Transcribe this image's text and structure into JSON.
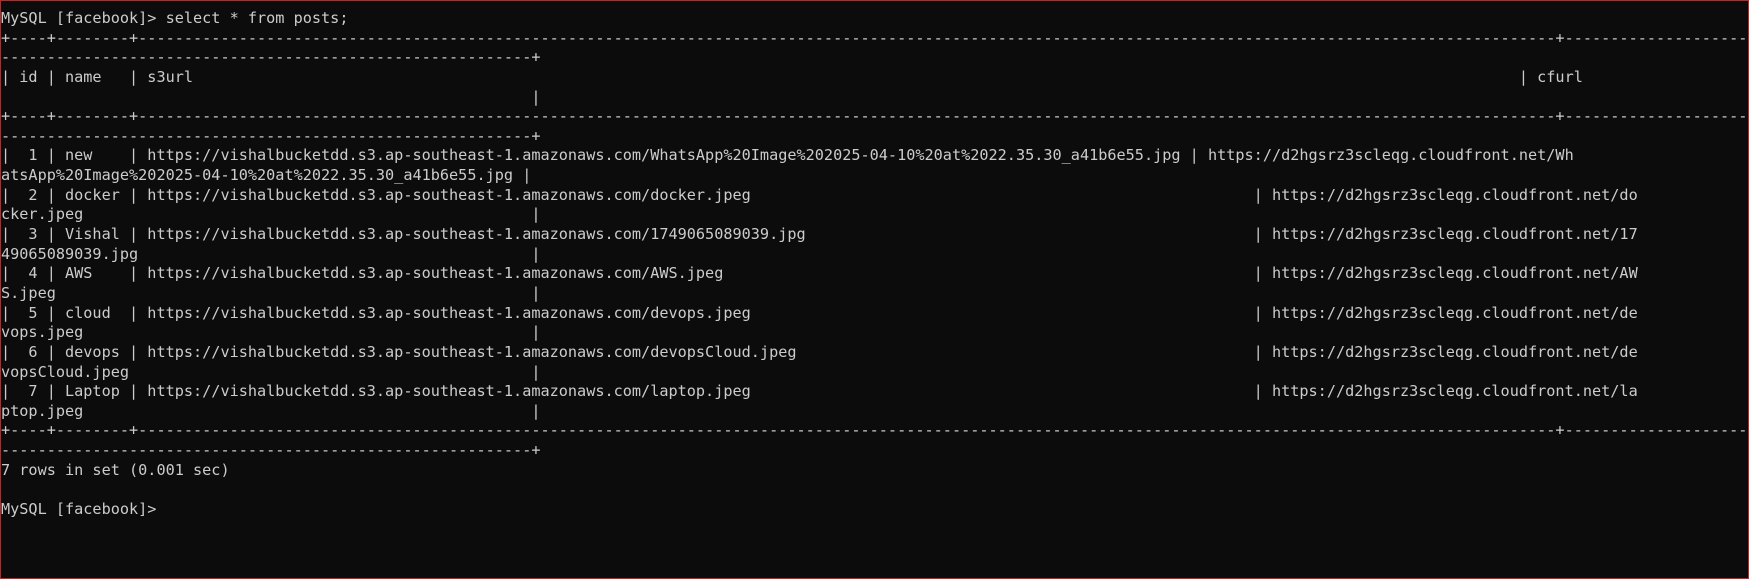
{
  "terminal": {
    "lines": [
      "MySQL [facebook]> select * from posts;",
      "+----+--------+-------------------------------------------------------------------------------------------------------------------------+-----------------------------------------------------------------------------------------------------------------------------+",
      "| id | name   | s3url                                                                                                                   | cfurl                                                                                                                       |",
      "+----+--------+-------------------------------------------------------------------------------------------------------------------------+-----------------------------------------------------------------------------------------------------------------------------+",
      "|  1 | new    | https://vishalbucketdd.s3.ap-southeast-1.amazonaws.com/WhatsApp%20Image%202025-04-10%20at%2022.35.30_a41b6e55.jpg | https://d2hgsrz3scleqg.cloudfront.net/WhatsApp%20Image%202025-04-10%20at%2022.35.30_a41b6e55.jpg |",
      "|  2 | docker | https://vishalbucketdd.s3.ap-southeast-1.amazonaws.com/docker.jpeg                                                      | https://d2hgsrz3scleqg.cloudfront.net/docker.jpeg                                                                          |",
      "|  3 | Vishal | https://vishalbucketdd.s3.ap-southeast-1.amazonaws.com/1749065089039.jpg                                                | https://d2hgsrz3scleqg.cloudfront.net/1749065089039.jpg                                                                    |",
      "|  4 | AWS    | https://vishalbucketdd.s3.ap-southeast-1.amazonaws.com/AWS.jpeg                                                         | https://d2hgsrz3scleqg.cloudfront.net/AWS.jpeg                                                                             |",
      "|  5 | cloud  | https://vishalbucketdd.s3.ap-southeast-1.amazonaws.com/devops.jpeg                                                      | https://d2hgsrz3scleqg.cloudfront.net/devops.jpeg                                                                          |",
      "|  6 | devops | https://vishalbucketdd.s3.ap-southeast-1.amazonaws.com/devopsCloud.jpeg                                                 | https://d2hgsrz3scleqg.cloudfront.net/devopsCloud.jpeg                                                                     |",
      "|  7 | Laptop | https://vishalbucketdd.s3.ap-southeast-1.amazonaws.com/laptop.jpeg                                                      | https://d2hgsrz3scleqg.cloudfront.net/laptop.jpeg                                                                          |",
      "+----+--------+-------------------------------------------------------------------------------------------------------------------------+-----------------------------------------------------------------------------------------------------------------------------+",
      "7 rows in set (0.001 sec)",
      "",
      "MySQL [facebook]>"
    ],
    "wrapped_display": [
      "MySQL [facebook]> select * from posts;",
      "+----+--------+-----------------------------------------------------------------------------------------------------------------------------------------------------------+-------------------------------------------------------------------------------------------------------------------------------------------------------------------------------------",
      "----------------------------------------------------------+",
      "| id | name   | s3url                                                                                                                                                 | cfurl",
      "                                                          |",
      "+----+--------+-----------------------------------------------------------------------------------------------------------------------------------------------------------+-------------------------------------------------------------------------------------------------------------------------------------------------------------------------------------",
      "----------------------------------------------------------+",
      "|  1 | new    | https://vishalbucketdd.s3.ap-southeast-1.amazonaws.com/WhatsApp%20Image%202025-04-10%20at%2022.35.30_a41b6e55.jpg | https://d2hgsrz3scleqg.cloudfront.net/Wh",
      "atsApp%20Image%202025-04-10%20at%2022.35.30_a41b6e55.jpg |",
      "|  2 | docker | https://vishalbucketdd.s3.ap-southeast-1.amazonaws.com/docker.jpeg                                                       | https://d2hgsrz3scleqg.cloudfront.net/do",
      "cker.jpeg                                                 |",
      "|  3 | Vishal | https://vishalbucketdd.s3.ap-southeast-1.amazonaws.com/1749065089039.jpg                                                 | https://d2hgsrz3scleqg.cloudfront.net/17",
      "49065089039.jpg                                           |",
      "|  4 | AWS    | https://vishalbucketdd.s3.ap-southeast-1.amazonaws.com/AWS.jpeg                                                          | https://d2hgsrz3scleqg.cloudfront.net/AW",
      "S.jpeg                                                    |",
      "|  5 | cloud  | https://vishalbucketdd.s3.ap-southeast-1.amazonaws.com/devops.jpeg                                                       | https://d2hgsrz3scleqg.cloudfront.net/de",
      "vops.jpeg                                                 |",
      "|  6 | devops | https://vishalbucketdd.s3.ap-southeast-1.amazonaws.com/devopsCloud.jpeg                                                  | https://d2hgsrz3scleqg.cloudfront.net/de",
      "vopsCloud.jpeg                                            |",
      "|  7 | Laptop | https://vishalbucketdd.s3.ap-southeast-1.amazonaws.com/laptop.jpeg                                                       | https://d2hgsrz3scleqg.cloudfront.net/la",
      "ptop.jpeg                                                 |",
      "+----+--------+-----------------------------------------------------------------------------------------------------------------------------------------------------------+-------------------------------------------------------------------------------------------------------------------------------------------------------------------------------------",
      "----------------------------------------------------------+",
      "7 rows in set (0.001 sec)",
      "",
      "MySQL [facebook]>"
    ]
  },
  "colors": {
    "background": "#0c0c0c",
    "text": "#cccccc",
    "window_border": "#d11f1f"
  }
}
